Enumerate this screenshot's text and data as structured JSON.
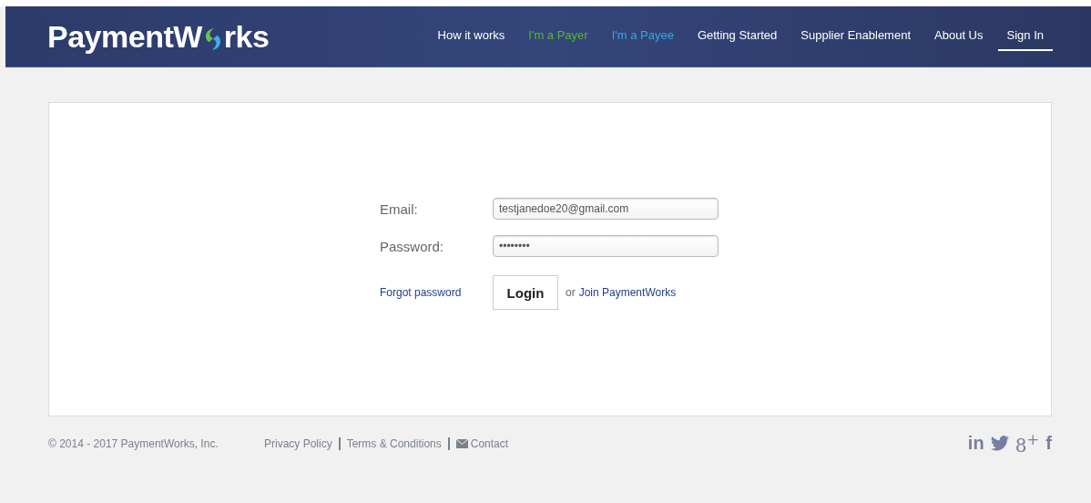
{
  "header": {
    "logo": {
      "before": "PaymentW",
      "after": "rks"
    },
    "nav": [
      {
        "label": "How it works",
        "color": "#ffffff",
        "selected": false
      },
      {
        "label": "I'm a Payer",
        "color": "#55b63a",
        "selected": false
      },
      {
        "label": "I'm a Payee",
        "color": "#35a8e0",
        "selected": false
      },
      {
        "label": "Getting Started",
        "color": "#ffffff",
        "selected": false
      },
      {
        "label": "Supplier Enablement",
        "color": "#ffffff",
        "selected": false
      },
      {
        "label": "About Us",
        "color": "#ffffff",
        "selected": false
      },
      {
        "label": "Sign In",
        "color": "#ffffff",
        "selected": true
      }
    ]
  },
  "form": {
    "fields": [
      {
        "label": "Email:",
        "value": "testjanedoe20@gmail.com"
      },
      {
        "label": "Password:",
        "value": "••••••••"
      }
    ],
    "forgot": "Forgot password",
    "login": "Login",
    "or": "or",
    "join": "Join PaymentWorks"
  },
  "footer": {
    "copyright": "© 2014 - 2017 PaymentWorks, Inc.",
    "links": [
      {
        "label": "Privacy Policy",
        "kind": "plain"
      },
      {
        "label": "Terms & Conditions",
        "kind": "plain"
      },
      {
        "label": "Contact",
        "kind": "mail"
      }
    ],
    "social": [
      {
        "kind": "text",
        "label": "in"
      },
      {
        "kind": "bird"
      },
      {
        "kind": "text",
        "label": "8$^{+}$"
      },
      {
        "kind": "text",
        "label": "f"
      }
    ]
  }
}
